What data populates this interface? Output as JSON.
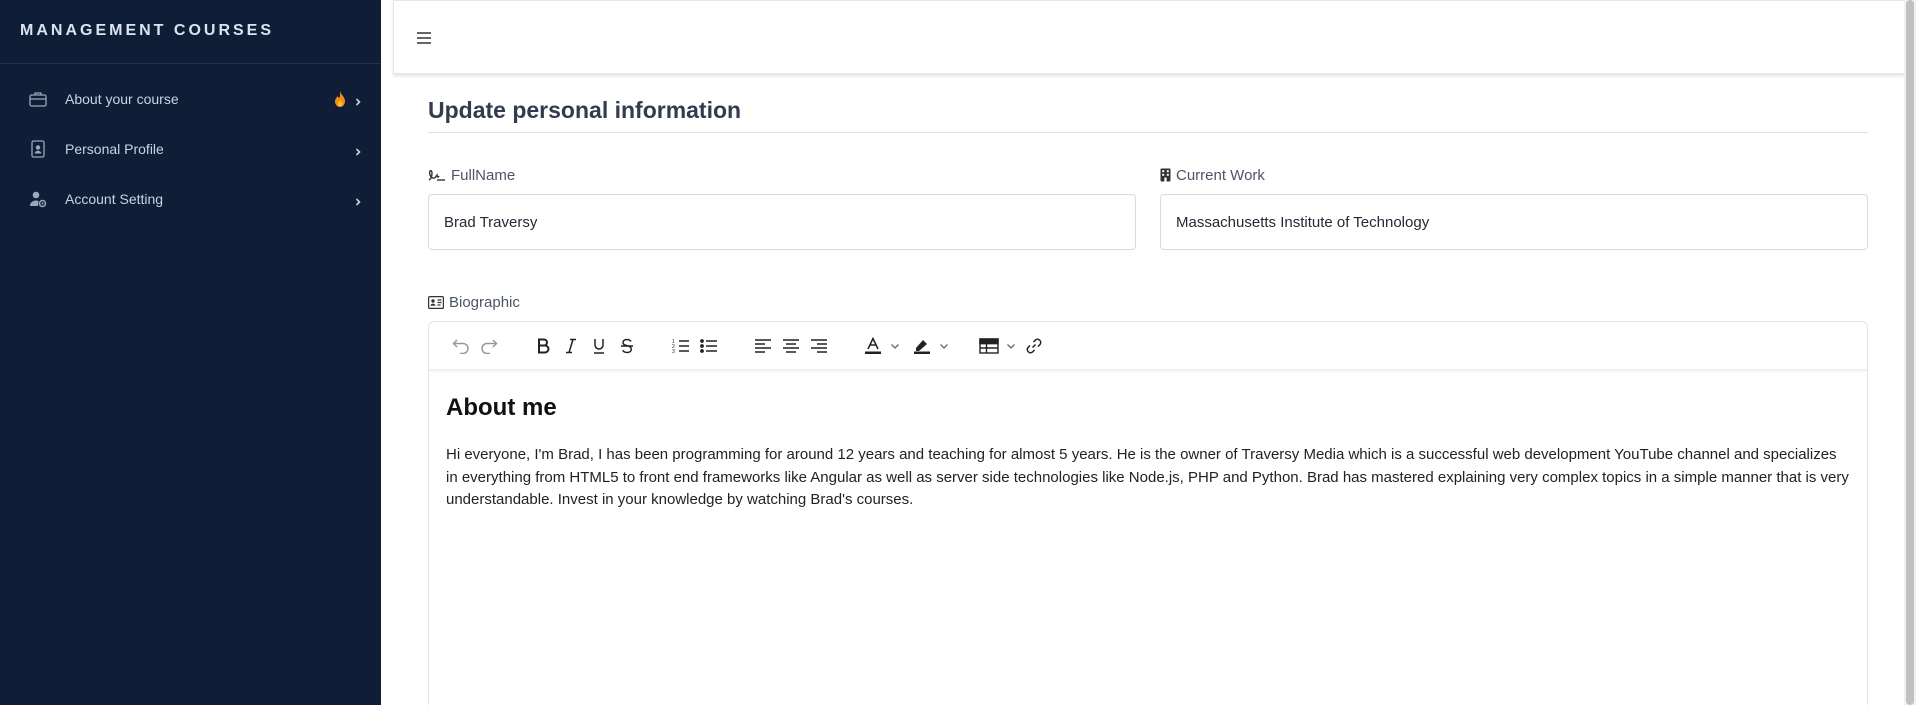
{
  "sidebar": {
    "brand": "MANAGEMENT COURSES",
    "items": [
      {
        "label": "About your course",
        "icon": "briefcase-icon",
        "badge": "fire-icon"
      },
      {
        "label": "Personal Profile",
        "icon": "id-badge-icon"
      },
      {
        "label": "Account Setting",
        "icon": "user-gear-icon"
      }
    ]
  },
  "topbar": {
    "menu_icon": "hamburger-icon"
  },
  "page": {
    "title": "Update personal information",
    "fullname": {
      "label": "FullName",
      "value": "Brad Traversy"
    },
    "current_work": {
      "label": "Current Work",
      "value": "Massachusetts Institute of Technology"
    },
    "biographic": {
      "label": "Biographic",
      "heading": "About me",
      "body": "Hi everyone, I'm Brad, I has been programming for around 12 years and teaching for almost 5 years. He is the owner of Traversy Media which is a successful web development YouTube channel and specializes in everything from HTML5 to front end frameworks like Angular as well as server side technologies like Node.js, PHP and Python. Brad has mastered explaining very complex topics in a simple manner that is very understandable. Invest in your knowledge by watching Brad's courses."
    }
  },
  "toolbar": {
    "buttons": [
      "undo-icon",
      "redo-icon",
      "bold-icon",
      "italic-icon",
      "underline-icon",
      "strikethrough-icon",
      "numbered-list-icon",
      "bulleted-list-icon",
      "align-left-icon",
      "align-center-icon",
      "align-right-icon",
      "font-color-icon",
      "highlight-icon",
      "table-icon",
      "link-icon"
    ]
  },
  "colors": {
    "sidebar_bg": "#0f1d37",
    "sidebar_text": "#c9d2e2",
    "fire": "#f28c1b"
  }
}
